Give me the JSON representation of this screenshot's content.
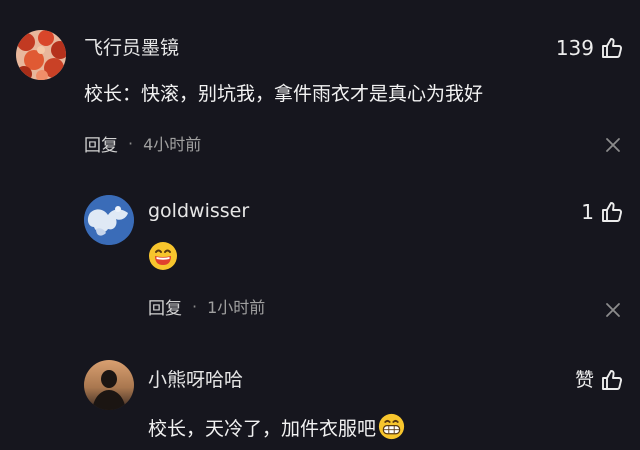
{
  "comments": [
    {
      "username": "飞行员墨镜",
      "text": "校长：快滚，别坑我，拿件雨衣才是真心为我好",
      "likes": "139",
      "meta": {
        "reply_label": "回复",
        "separator": "·",
        "time": "4小时前"
      }
    },
    {
      "username": "goldwisser",
      "likes": "1",
      "meta": {
        "reply_label": "回复",
        "separator": "·",
        "time": "1小时前"
      }
    },
    {
      "username": "小熊呀哈哈",
      "text": "校长，天冷了，加件衣服吧",
      "likes": "赞"
    }
  ],
  "colors": {
    "background": "#16161e",
    "text": "#f2f2f2",
    "meta": "#a8a8a8",
    "emoji": "#f7c52d"
  },
  "icons": [
    "thumbs-up-icon",
    "close-icon",
    "grinning-emoji-icon"
  ]
}
